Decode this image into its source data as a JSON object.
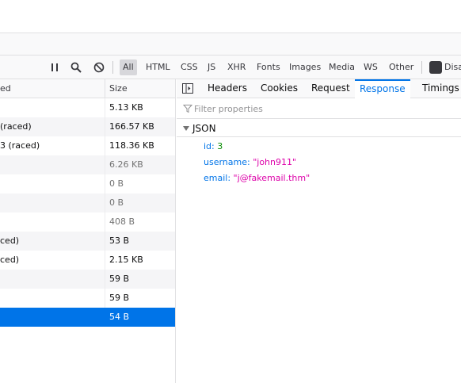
{
  "toolbar": {
    "filters": [
      "All",
      "HTML",
      "CSS",
      "JS",
      "XHR",
      "Fonts",
      "Images",
      "Media",
      "WS",
      "Other"
    ],
    "active_filter": "All",
    "disable_cache_label": "Disa"
  },
  "requests": {
    "columns": [
      "ed",
      "Size"
    ],
    "rows": [
      {
        "transferred": "",
        "size": "5.13 KB",
        "cached": false
      },
      {
        "transferred": "(raced)",
        "size": "166.57 KB",
        "cached": false
      },
      {
        "transferred": "3 (raced)",
        "size": "118.36 KB",
        "cached": false
      },
      {
        "transferred": "",
        "size": "6.26 KB",
        "cached": true
      },
      {
        "transferred": "",
        "size": "0 B",
        "cached": true
      },
      {
        "transferred": "",
        "size": "0 B",
        "cached": true
      },
      {
        "transferred": "",
        "size": "408 B",
        "cached": true
      },
      {
        "transferred": "ced)",
        "size": "53 B",
        "cached": false
      },
      {
        "transferred": "ced)",
        "size": "2.15 KB",
        "cached": false
      },
      {
        "transferred": "",
        "size": "59 B",
        "cached": false
      },
      {
        "transferred": "",
        "size": "59 B",
        "cached": false
      },
      {
        "transferred": "",
        "size": "54 B",
        "cached": false,
        "selected": true
      }
    ]
  },
  "details": {
    "tabs": [
      "Headers",
      "Cookies",
      "Request",
      "Response",
      "Timings"
    ],
    "active_tab": "Response",
    "filter_placeholder": "Filter properties",
    "section_label": "JSON",
    "json": [
      {
        "key": "id:",
        "value": "3",
        "type": "number"
      },
      {
        "key": "username:",
        "value": "\"john911\"",
        "type": "string"
      },
      {
        "key": "email:",
        "value": "\"j@fakemail.thm\"",
        "type": "string"
      }
    ]
  },
  "colors": {
    "accent": "#0074e8",
    "json_number": "#058b00",
    "json_string": "#dd00a9"
  }
}
